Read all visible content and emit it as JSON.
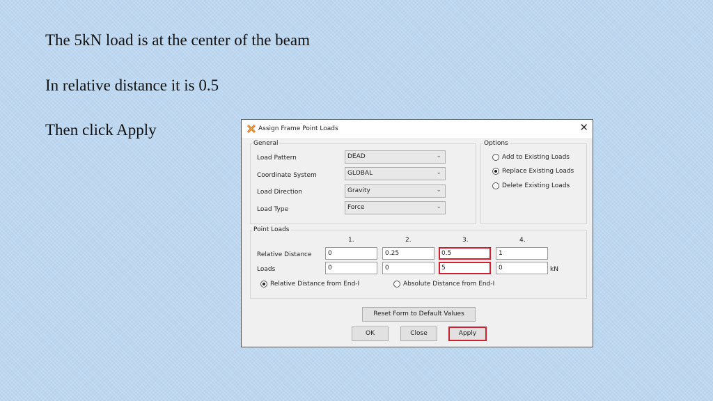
{
  "slide": {
    "line1": "The 5kN load is at the center of the beam",
    "line2": "In relative distance it is 0.5",
    "line3": "Then click Apply"
  },
  "dialog": {
    "title": "Assign Frame Point Loads",
    "close_glyph": "✕",
    "general": {
      "legend": "General",
      "load_pattern_label": "Load Pattern",
      "load_pattern_value": "DEAD",
      "coord_system_label": "Coordinate System",
      "coord_system_value": "GLOBAL",
      "load_direction_label": "Load Direction",
      "load_direction_value": "Gravity",
      "load_type_label": "Load Type",
      "load_type_value": "Force"
    },
    "options": {
      "legend": "Options",
      "items": [
        "Add to Existing Loads",
        "Replace Existing Loads",
        "Delete Existing Loads"
      ],
      "selected": "Replace Existing Loads"
    },
    "point_loads": {
      "legend": "Point Loads",
      "columns": [
        "1.",
        "2.",
        "3.",
        "4."
      ],
      "relative_distance_label": "Relative Distance",
      "relative_distance_values": [
        "0",
        "0.25",
        "0.5",
        "1"
      ],
      "loads_label": "Loads",
      "loads_values": [
        "0",
        "0",
        "5",
        "0"
      ],
      "unit": "kN",
      "radio_relative": "Relative Distance from End-I",
      "radio_absolute": "Absolute Distance from End-I",
      "radio_selected": "Relative Distance from End-I"
    },
    "buttons": {
      "reset": "Reset Form to Default Values",
      "ok": "OK",
      "close": "Close",
      "apply": "Apply"
    },
    "highlight_color": "#d02030"
  },
  "icons": {
    "app": "x-beam-app-icon",
    "chevron": "chevron-down-icon",
    "close": "close-icon"
  }
}
